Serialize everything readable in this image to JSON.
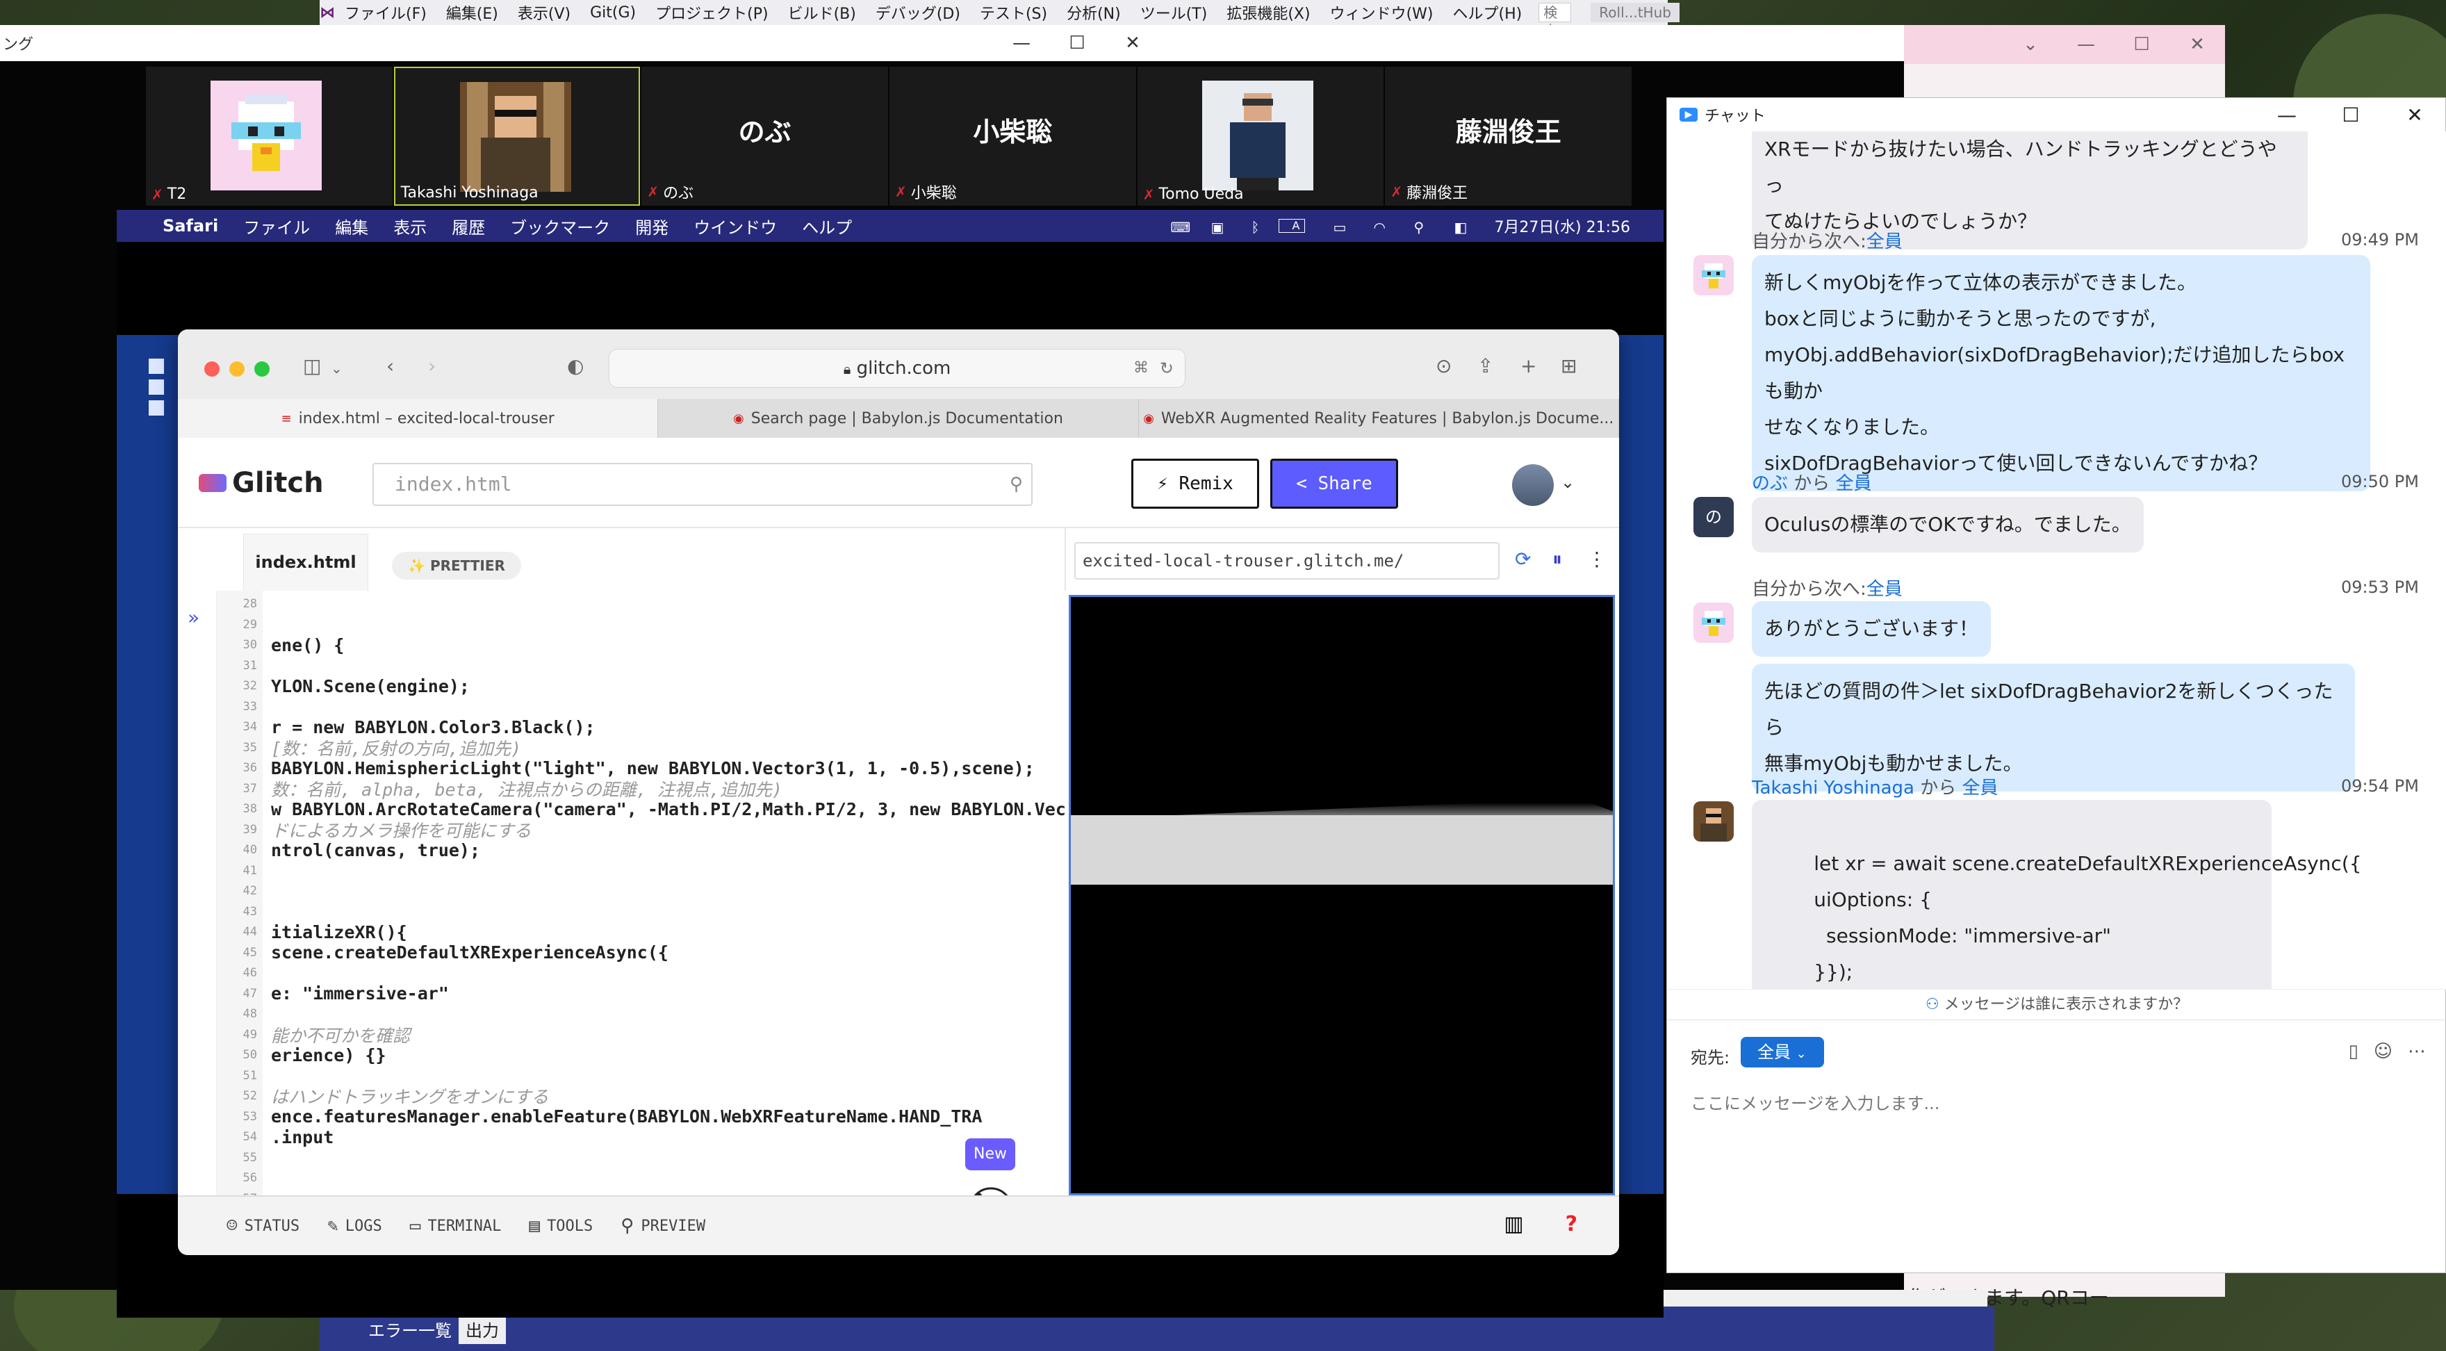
{
  "vs": {
    "menu": [
      "ファイル(F)",
      "編集(E)",
      "表示(V)",
      "Git(G)",
      "プロジェクト(P)",
      "ビルド(B)",
      "デバッグ(D)",
      "テスト(S)",
      "分析(N)",
      "ツール(T)",
      "拡張機能(X)",
      "ウィンドウ(W)",
      "ヘルプ(H)"
    ],
    "search_label": "検索...",
    "title_tab": "Roll...tHub",
    "bottom_tabs": [
      "エラー一覧",
      "出力"
    ],
    "behind_text": "化ができます。QRコー"
  },
  "meeting": {
    "title_fragment": "ング",
    "participants": [
      {
        "name": "T2",
        "type": "avatar"
      },
      {
        "name": "Takashi Yoshinaga",
        "type": "photo"
      },
      {
        "name": "のぶ",
        "type": "name"
      },
      {
        "name": "小柴聡",
        "type": "name"
      },
      {
        "name": "Tomo Ueda",
        "type": "photo"
      },
      {
        "name": "藤淵俊王",
        "type": "name"
      }
    ]
  },
  "mac": {
    "apple": "",
    "app_name": "Safari",
    "menu": [
      "ファイル",
      "編集",
      "表示",
      "履歴",
      "ブックマーク",
      "開発",
      "ウインドウ",
      "ヘルプ"
    ],
    "input_mode": "A",
    "datetime": "7月27日(水) 21:56"
  },
  "safari": {
    "url": "glitch.com",
    "tabs": [
      "index.html – excited-local-trouser",
      "Search page | Babylon.js Documentation",
      "WebXR Augmented Reality Features | Babylon.js Docume..."
    ]
  },
  "glitch": {
    "logo_text": "Glitch",
    "search_placeholder": "index.html",
    "remix_label": "⚡ Remix",
    "share_label": "< Share",
    "file_tab": "index.html",
    "prettier_label": "✨ PRETTIER",
    "preview_url": "excited-local-trouser.glitch.me/",
    "new_badge": "New",
    "footer": [
      "STATUS",
      "LOGS",
      "TERMINAL",
      "TOOLS",
      "PREVIEW"
    ],
    "code": [
      {
        "n": "28",
        "t": ""
      },
      {
        "n": "29",
        "t": ""
      },
      {
        "n": "30",
        "t": "ene() {",
        "style": "bold"
      },
      {
        "n": "31",
        "t": ""
      },
      {
        "n": "32",
        "t": "YLON.Scene(engine);",
        "style": "bold"
      },
      {
        "n": "33",
        "t": ""
      },
      {
        "n": "34",
        "t": "r = new BABYLON.Color3.Black();",
        "style": "bold"
      },
      {
        "n": "35",
        "t": "[数：名前,反射の方向,追加先)",
        "style": "comment"
      },
      {
        "n": "36",
        "t": " BABYLON.HemisphericLight(\"light\", new BABYLON.Vector3(1, 1, -0.5),scene);",
        "style": "bold"
      },
      {
        "n": "37",
        "t": "数：名前, alpha, beta, 注視点からの距離, 注視点,追加先)",
        "style": "comment"
      },
      {
        "n": "38",
        "t": "w BABYLON.ArcRotateCamera(\"camera\", -Math.PI/2,Math.PI/2, 3, new BABYLON.Vec",
        "style": "bold"
      },
      {
        "n": "39",
        "t": "ドによるカメラ操作を可能にする",
        "style": "comment"
      },
      {
        "n": "40",
        "t": "ntrol(canvas, true);",
        "style": "bold"
      },
      {
        "n": "41",
        "t": ""
      },
      {
        "n": "42",
        "t": ""
      },
      {
        "n": "43",
        "t": ""
      },
      {
        "n": "44",
        "t": "itializeXR(){",
        "style": "bold"
      },
      {
        "n": "45",
        "t": "scene.createDefaultXRExperienceAsync({",
        "style": "bold"
      },
      {
        "n": "46",
        "t": ""
      },
      {
        "n": "47",
        "t": "e: \"immersive-ar\"",
        "style": "bold"
      },
      {
        "n": "48",
        "t": ""
      },
      {
        "n": "49",
        "t": "能か不可かを確認",
        "style": "comment"
      },
      {
        "n": "50",
        "t": "erience) {}",
        "style": "bold"
      },
      {
        "n": "51",
        "t": ""
      },
      {
        "n": "52",
        "t": "はハンドトラッキングをオンにする",
        "style": "comment"
      },
      {
        "n": "53",
        "t": "ence.featuresManager.enableFeature(BABYLON.WebXRFeatureName.HAND_TRA",
        "style": "bold"
      },
      {
        "n": "54",
        "t": ".input",
        "style": "bold"
      },
      {
        "n": "55",
        "t": ""
      },
      {
        "n": "56",
        "t": ""
      },
      {
        "n": "57",
        "t": ""
      }
    ]
  },
  "chat": {
    "title": "チャット",
    "messages": [
      {
        "kind": "text",
        "text": "XRモードから抜けたい場合、ハンドトラッキングとどうやっ\nてぬけたらよいのでしょうか？"
      },
      {
        "kind": "head",
        "from": "自分から次へ:",
        "to": "全員",
        "time": "09:49 PM"
      },
      {
        "kind": "text",
        "text": "新しくmyObjを作って立体の表示ができました。\nboxと同じように動かそうと思ったのですが,\nmyObj.addBehavior(sixDofDragBehavior);だけ追加したらboxも動か\nせなくなりました。\nsixDofDragBehaviorって使い回しできないんですかね？"
      },
      {
        "kind": "head",
        "from": "のぶ",
        "mid": " から ",
        "to": "全員",
        "time": "09:50 PM",
        "avatar": "の"
      },
      {
        "kind": "text",
        "text": "Oculusの標準のでOKですね。でました。"
      },
      {
        "kind": "head",
        "from": "自分から次へ:",
        "to": "全員",
        "time": "09:53 PM"
      },
      {
        "kind": "text",
        "text": "ありがとうございます！"
      },
      {
        "kind": "text",
        "text": "先ほどの質問の件＞let sixDofDragBehavior2を新しくつくったら\n無事myObjも動かせました。"
      },
      {
        "kind": "head",
        "from": "Takashi Yoshinaga",
        "mid": " から ",
        "to": "全員",
        "time": "09:54 PM"
      },
      {
        "kind": "text",
        "text": "let xr = await scene.createDefaultXRExperienceAsync({\n        uiOptions: {\n          sessionMode: \"immersive-ar\"\n        }});"
      }
    ],
    "who_sees": "メッセージは誰に表示されますか？",
    "to_label": "宛先:",
    "to_value": "全員",
    "input_placeholder": "ここにメッセージを入力します..."
  }
}
